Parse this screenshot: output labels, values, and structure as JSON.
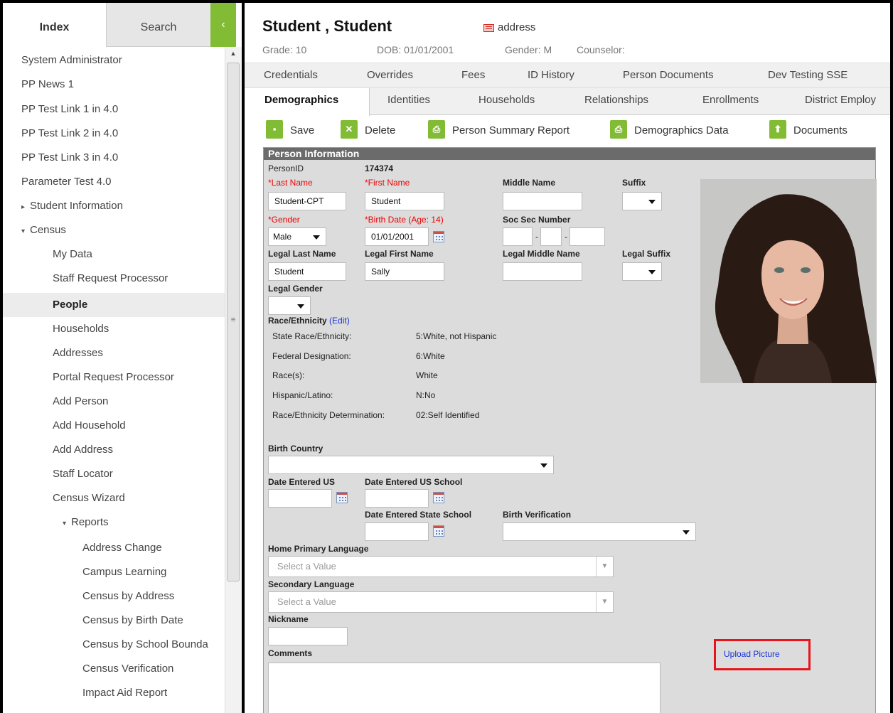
{
  "sidebar": {
    "tabs": {
      "index": "Index",
      "search": "Search"
    },
    "collapse_glyph": "‹",
    "items": [
      {
        "label": "System Administrator"
      },
      {
        "label": "PP News 1"
      },
      {
        "label": "PP Test Link 1 in 4.0"
      },
      {
        "label": "PP Test Link 2 in 4.0"
      },
      {
        "label": "PP Test Link 3 in 4.0"
      },
      {
        "label": "Parameter Test 4.0"
      },
      {
        "label": "Student Information"
      },
      {
        "label": "Census"
      },
      {
        "label": "My Data"
      },
      {
        "label": "Staff Request Processor"
      },
      {
        "label": "People"
      },
      {
        "label": "Households"
      },
      {
        "label": "Addresses"
      },
      {
        "label": "Portal Request Processor"
      },
      {
        "label": "Add Person"
      },
      {
        "label": "Add Household"
      },
      {
        "label": "Add Address"
      },
      {
        "label": "Staff Locator"
      },
      {
        "label": "Census Wizard"
      },
      {
        "label": "Reports"
      },
      {
        "label": "Address Change"
      },
      {
        "label": "Campus Learning"
      },
      {
        "label": "Census by Address"
      },
      {
        "label": "Census by Birth Date"
      },
      {
        "label": "Census by School Bounda"
      },
      {
        "label": "Census Verification"
      },
      {
        "label": "Impact Aid Report"
      }
    ]
  },
  "header": {
    "name": "Student , Student",
    "address_link": "address",
    "grade": "Grade: 10",
    "dob": "DOB: 01/01/2001",
    "gender": "Gender: M",
    "counselor": "Counselor:"
  },
  "tabs_row1": [
    "Credentials",
    "Overrides",
    "Fees",
    "ID History",
    "Person Documents",
    "Dev Testing SSE"
  ],
  "tabs_row2": [
    "Demographics",
    "Identities",
    "Households",
    "Relationships",
    "Enrollments",
    "District Employ"
  ],
  "toolbar": {
    "save": "Save",
    "delete": "Delete",
    "summary": "Person Summary Report",
    "demographics": "Demographics Data",
    "documents": "Documents"
  },
  "form": {
    "panel_title": "Person Information",
    "person_id_label": "PersonID",
    "person_id": "174374",
    "last_name_label": "*Last Name",
    "last_name": "Student-CPT",
    "first_name_label": "*First Name",
    "first_name": "Student",
    "middle_name_label": "Middle Name",
    "suffix_label": "Suffix",
    "gender_label": "*Gender",
    "gender": "Male",
    "birth_date_label": "*Birth Date (Age: 14)",
    "birth_date": "01/01/2001",
    "ssn_label": "Soc Sec Number",
    "ssn_sep": "-",
    "legal_last_label": "Legal Last Name",
    "legal_last": "Student",
    "legal_first_label": "Legal First Name",
    "legal_first": "Sally",
    "legal_middle_label": "Legal Middle Name",
    "legal_suffix_label": "Legal Suffix",
    "legal_gender_label": "Legal Gender",
    "race_heading": "Race/Ethnicity",
    "race_edit": "(Edit)",
    "race_rows": [
      {
        "label": "State Race/Ethnicity:",
        "value": "5:White, not Hispanic"
      },
      {
        "label": "Federal Designation:",
        "value": "6:White"
      },
      {
        "label": "Race(s):",
        "value": "White"
      },
      {
        "label": "Hispanic/Latino:",
        "value": "N:No"
      },
      {
        "label": "Race/Ethnicity Determination:",
        "value": "02:Self Identified"
      }
    ],
    "birth_country_label": "Birth Country",
    "date_entered_us_label": "Date Entered US",
    "date_entered_us_school_label": "Date Entered US School",
    "date_entered_state_school_label": "Date Entered State School",
    "birth_verification_label": "Birth Verification",
    "home_language_label": "Home Primary Language",
    "home_language_placeholder": "Select a Value",
    "secondary_language_label": "Secondary Language",
    "secondary_language_placeholder": "Select a Value",
    "nickname_label": "Nickname",
    "comments_label": "Comments",
    "upload_picture": "Upload Picture"
  },
  "colors": {
    "accent_green": "#82bc34",
    "required_red": "#ee0000",
    "link_blue": "#1a33d8",
    "highlight_red": "#e8141c",
    "panel_header": "#6b6b6b"
  },
  "icons": {
    "save": "floppy-disk-icon",
    "delete": "x-circle-icon",
    "summary": "printer-icon",
    "demographics": "printer-icon",
    "documents": "upload-icon",
    "address": "address-card-icon",
    "calendar": "calendar-icon"
  }
}
